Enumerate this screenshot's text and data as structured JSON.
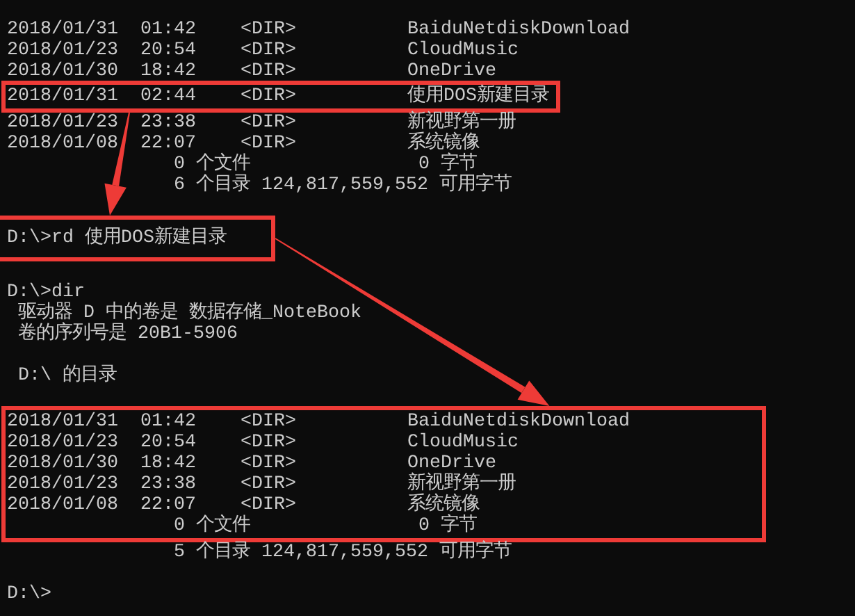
{
  "console": {
    "blocks": [
      {
        "highlighted": false,
        "lines": [
          {
            "kind": "entry",
            "date": "2018/01/31",
            "time": "01:42",
            "type": "<DIR>",
            "name": "BaiduNetdiskDownload"
          },
          {
            "kind": "entry",
            "date": "2018/01/23",
            "time": "20:54",
            "type": "<DIR>",
            "name": "CloudMusic"
          },
          {
            "kind": "entry",
            "date": "2018/01/30",
            "time": "18:42",
            "type": "<DIR>",
            "name": "OneDrive"
          }
        ]
      },
      {
        "highlighted": true,
        "lines": [
          {
            "kind": "entry",
            "date": "2018/01/31",
            "time": "02:44",
            "type": "<DIR>",
            "name": "使用DOS新建目录"
          }
        ]
      },
      {
        "highlighted": false,
        "lines": [
          {
            "kind": "entry",
            "date": "2018/01/23",
            "time": "23:38",
            "type": "<DIR>",
            "name": "新视野第一册"
          },
          {
            "kind": "entry",
            "date": "2018/01/08",
            "time": "22:07",
            "type": "<DIR>",
            "name": "系统镜像"
          },
          {
            "kind": "summary",
            "text": "0 个文件",
            "size": "0 字节"
          },
          {
            "kind": "summary",
            "text": "6 个目录 124,817,559,552 可用字节"
          },
          {
            "kind": "blank"
          }
        ]
      },
      {
        "highlighted": true,
        "lines": [
          {
            "kind": "prompt",
            "text": "D:\\>rd 使用DOS新建目录"
          }
        ]
      },
      {
        "highlighted": false,
        "lines": [
          {
            "kind": "blank"
          },
          {
            "kind": "prompt",
            "text": "D:\\>dir"
          },
          {
            "kind": "info",
            "text": "驱动器 D 中的卷是 数据存储_NoteBook"
          },
          {
            "kind": "info",
            "text": "卷的序列号是 20B1-5906"
          },
          {
            "kind": "blank"
          },
          {
            "kind": "info",
            "text": "D:\\ 的目录"
          },
          {
            "kind": "blank"
          }
        ]
      },
      {
        "highlighted": true,
        "lines": [
          {
            "kind": "entry",
            "date": "2018/01/31",
            "time": "01:42",
            "type": "<DIR>",
            "name": "BaiduNetdiskDownload"
          },
          {
            "kind": "entry",
            "date": "2018/01/23",
            "time": "20:54",
            "type": "<DIR>",
            "name": "CloudMusic"
          },
          {
            "kind": "entry",
            "date": "2018/01/30",
            "time": "18:42",
            "type": "<DIR>",
            "name": "OneDrive"
          },
          {
            "kind": "entry",
            "date": "2018/01/23",
            "time": "23:38",
            "type": "<DIR>",
            "name": "新视野第一册"
          },
          {
            "kind": "entry",
            "date": "2018/01/08",
            "time": "22:07",
            "type": "<DIR>",
            "name": "系统镜像"
          },
          {
            "kind": "summary",
            "text": "0 个文件",
            "size": "0 字节"
          }
        ]
      },
      {
        "highlighted": false,
        "lines": [
          {
            "kind": "summary",
            "text": "5 个目录 124,817,559,552 可用字节"
          },
          {
            "kind": "blank"
          },
          {
            "kind": "prompt",
            "text": "D:\\>"
          }
        ]
      }
    ]
  }
}
